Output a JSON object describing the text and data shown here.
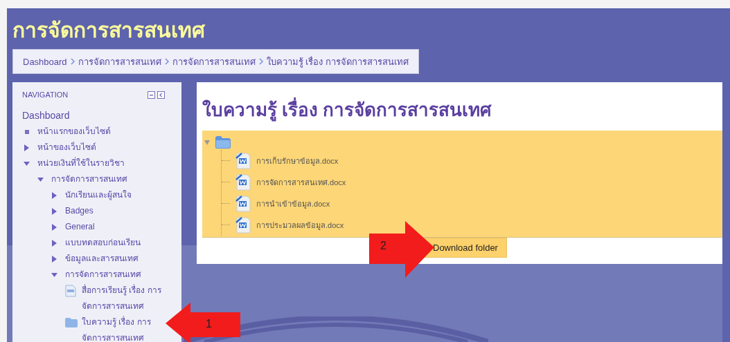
{
  "page_title": "การจัดการสารสนเทศ",
  "breadcrumb": [
    "Dashboard",
    "การจัดการสารสนเทศ",
    "การจัดการสารสนเทศ",
    "ใบความรู้ เรื่อง การจัดการสารสนเทศ"
  ],
  "navigation": {
    "title": "NAVIGATION",
    "items": [
      {
        "label": "Dashboard",
        "kind": "link"
      },
      {
        "label": "หน้าแรกของเว็บไซต์",
        "kind": "bullet"
      },
      {
        "label": "หน้าของเว็บไซต์",
        "kind": "branch",
        "expanded": false
      },
      {
        "label": "หน่วยเงินที่ใช้ในรายวิชา",
        "kind": "branch",
        "expanded": true,
        "children": [
          {
            "label": "การจัดการสารสนเทศ",
            "kind": "branch",
            "expanded": true,
            "children": [
              {
                "label": "นักเรียนและผู้สนใจ",
                "kind": "branch",
                "expanded": false
              },
              {
                "label": "Badges",
                "kind": "branch",
                "expanded": false
              },
              {
                "label": "General",
                "kind": "branch",
                "expanded": false
              },
              {
                "label": "แบบทดสอบก่อนเรียน",
                "kind": "branch",
                "expanded": false
              },
              {
                "label": "ข้อมูลและสารสนเทศ",
                "kind": "branch",
                "expanded": false
              },
              {
                "label": "การจัดการสารสนเทศ",
                "kind": "branch",
                "expanded": true,
                "children": [
                  {
                    "label": "สื่อการเรียนรู้ เรื่อง การจัดการสารสนเทศ",
                    "kind": "page"
                  },
                  {
                    "label": "ใบความรู้ เรื่อง การจัดการสารสนเทศ",
                    "kind": "folder"
                  }
                ]
              }
            ]
          }
        ]
      }
    ]
  },
  "content": {
    "title": "ใบความรู้ เรื่อง การจัดการสารสนเทศ",
    "folder": {
      "expanded": true,
      "files": [
        "การเก็บรักษาข้อมูล.docx",
        "การจัดการสารสนเทศ.docx",
        "การนำเข้าข้อมูล.docx",
        "การประมวลผลข้อมูล.docx"
      ]
    },
    "button": "Download folder"
  },
  "annotations": [
    {
      "label": "2",
      "kind": "arrow-right"
    },
    {
      "label": "1",
      "kind": "arrow-left"
    }
  ]
}
